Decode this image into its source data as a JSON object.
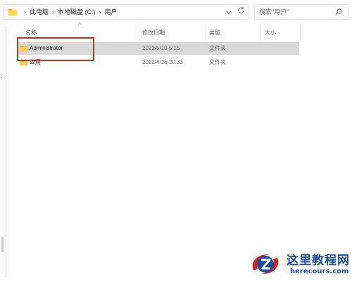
{
  "address_bar": {
    "breadcrumbs": [
      "此电脑",
      "本地磁盘 (C:)",
      "用户"
    ],
    "separator": "›"
  },
  "search": {
    "placeholder": "搜索\"用户\""
  },
  "columns": {
    "name": "名称",
    "modified": "修改日期",
    "type": "类型",
    "size": "大小"
  },
  "rows": [
    {
      "name": "Administrator",
      "modified": "2022/5/10 5:15",
      "type": "文件夹",
      "size": "",
      "selected": true
    },
    {
      "name": "公用",
      "modified": "2022/4/26 20:33",
      "type": "文件夹",
      "size": "",
      "selected": false
    }
  ],
  "watermark": {
    "title": "这里教程网",
    "url": "herecours.com"
  },
  "icons": {
    "address_folder": "folder-icon",
    "dropdown": "chevron-down-icon",
    "refresh": "refresh-icon",
    "search": "search-icon",
    "row_folder": "folder-icon"
  },
  "colors": {
    "selection": "#d9d9d9",
    "annotation": "#d9251d",
    "folder": "#f4c542",
    "watermark": "#1d4f9f"
  }
}
